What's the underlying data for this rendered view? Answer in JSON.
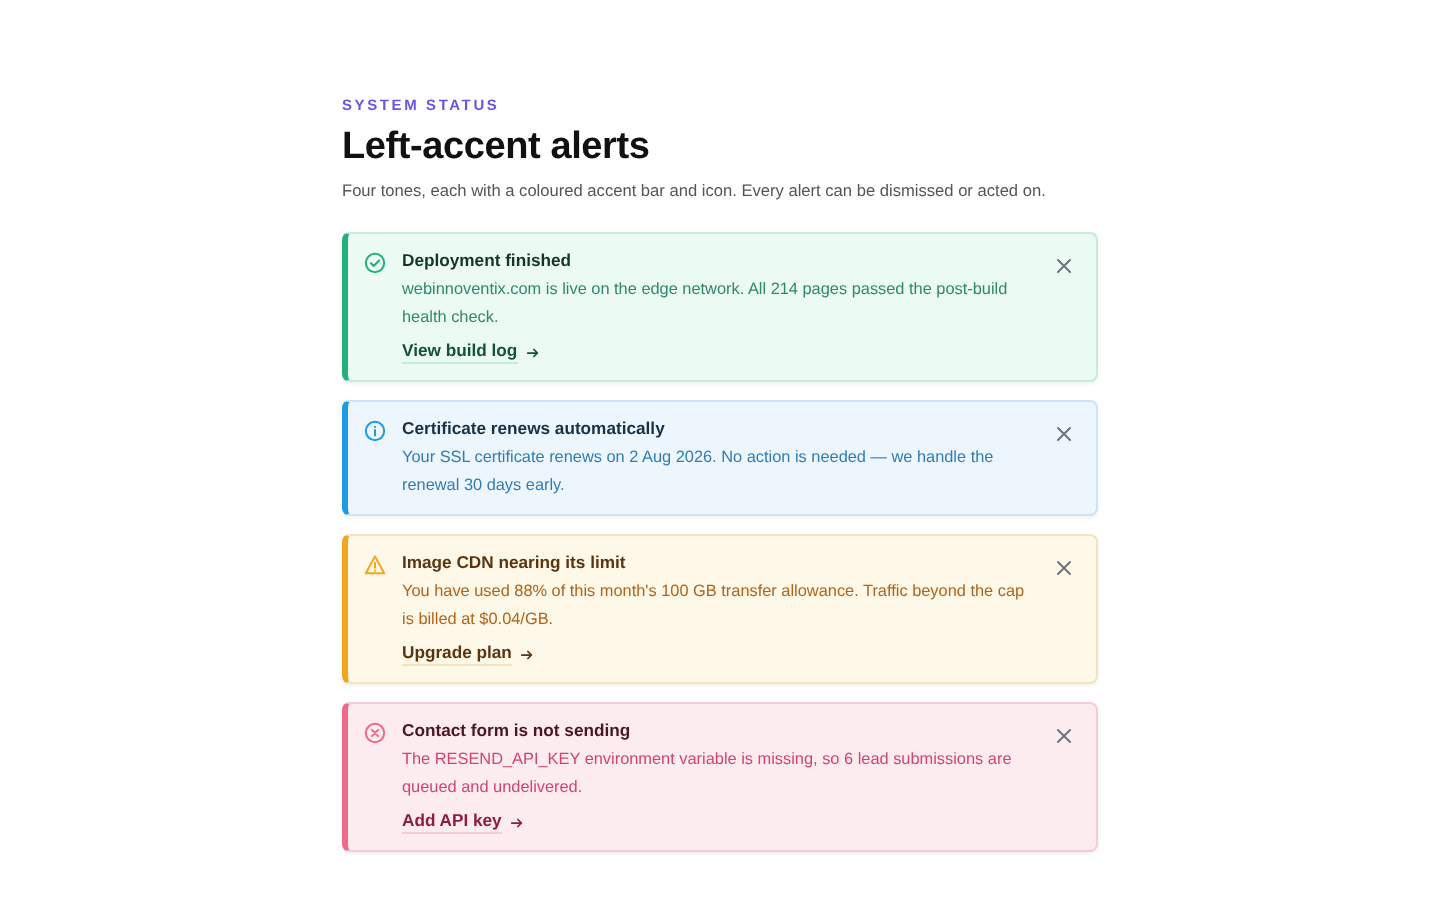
{
  "eyebrow": "SYSTEM STATUS",
  "title": "Left-accent alerts",
  "subtitle": "Four tones, each with a coloured accent bar and icon. Every alert can be dismissed or acted on.",
  "alerts": [
    {
      "kind": "success",
      "title": "Deployment finished",
      "message": "webinnoventix.com is live on the edge network. All 214 pages passed the post-build health check.",
      "action": "View build log"
    },
    {
      "kind": "info",
      "title": "Certificate renews automatically",
      "message": "Your SSL certificate renews on 2 Aug 2026. No action is needed — we handle the renewal 30 days early."
    },
    {
      "kind": "warning",
      "title": "Image CDN nearing its limit",
      "message": "You have used 88% of this month's 100 GB transfer allowance. Traffic beyond the cap is billed at $0.04/GB.",
      "action": "Upgrade plan"
    },
    {
      "kind": "error",
      "title": "Contact form is not sending",
      "message": "The RESEND_API_KEY environment variable is missing, so 6 lead submissions are queued and undelivered.",
      "action": "Add API key"
    }
  ]
}
